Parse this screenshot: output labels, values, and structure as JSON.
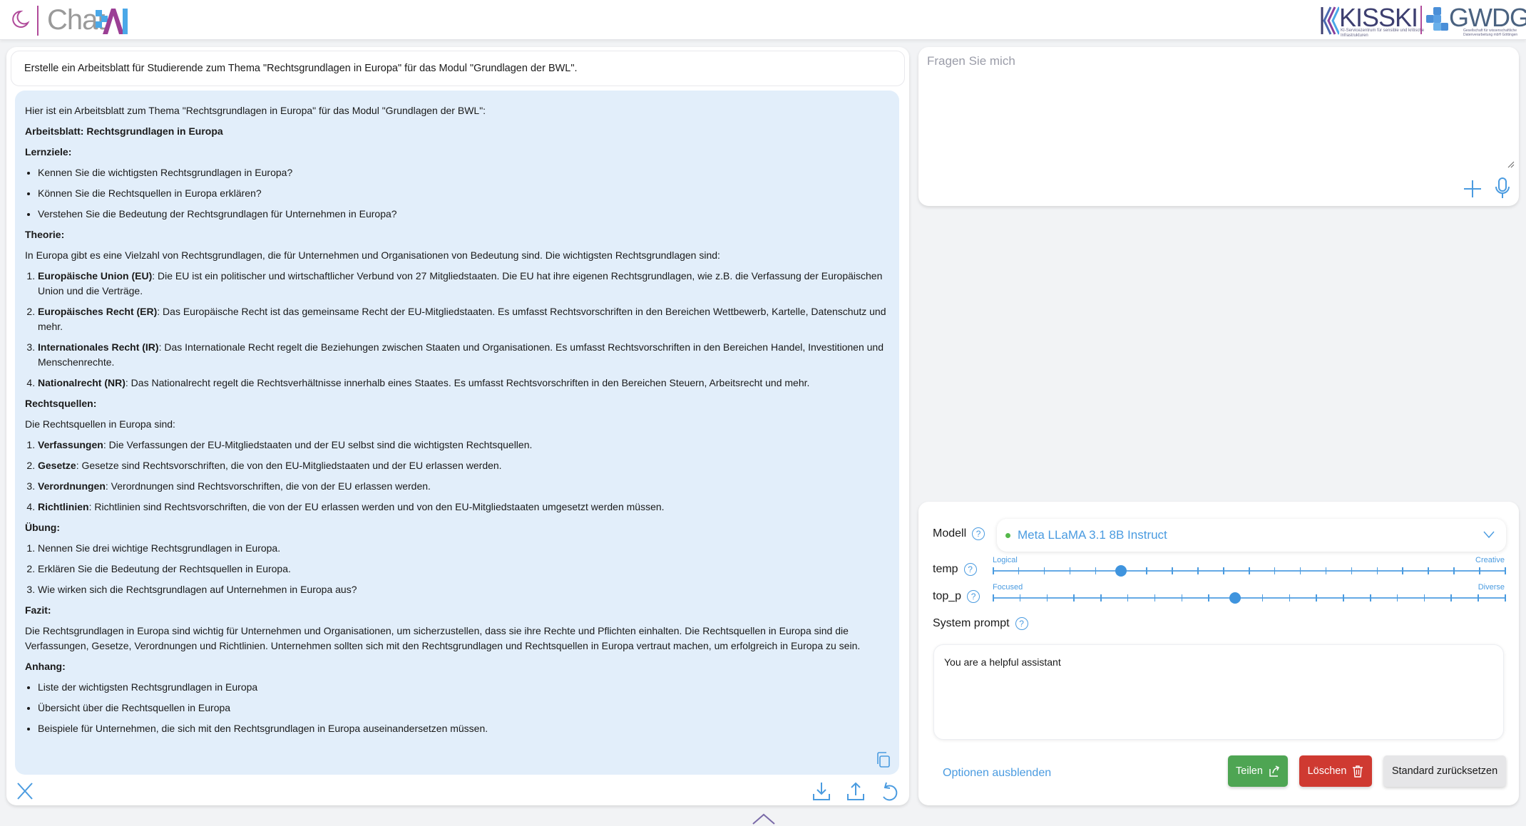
{
  "header": {
    "app_name_text": "Chat",
    "app_name_accent": "AI",
    "theme_icon": "moon-icon",
    "partner_logos": [
      {
        "name": "KISSKI",
        "subtitle": "KI-Servicezentrum für sensible und kritische Infrastrukturen"
      },
      {
        "name": "GWDG",
        "subtitle": "Gesellschaft für wissenschaftliche Datenverarbeitung mbH Göttingen"
      }
    ]
  },
  "chat": {
    "user_message": "Erstelle ein Arbeitsblatt für Studierende zum Thema \"Rechtsgrundlagen in Europa\" für das Modul \"Grundlagen der BWL\".",
    "assistant": {
      "intro": "Hier ist ein Arbeitsblatt zum Thema \"Rechtsgrundlagen in Europa\" für das Modul \"Grundlagen der BWL\":",
      "title": "Arbeitsblatt: Rechtsgrundlagen in Europa",
      "lernziele_heading": "Lernziele:",
      "lernziele": [
        "Kennen Sie die wichtigsten Rechtsgrundlagen in Europa?",
        "Können Sie die Rechtsquellen in Europa erklären?",
        "Verstehen Sie die Bedeutung der Rechtsgrundlagen für Unternehmen in Europa?"
      ],
      "theorie_heading": "Theorie:",
      "theorie_intro": "In Europa gibt es eine Vielzahl von Rechtsgrundlagen, die für Unternehmen und Organisationen von Bedeutung sind. Die wichtigsten Rechtsgrundlagen sind:",
      "theorie_items": [
        {
          "term": "Europäische Union (EU)",
          "text": ": Die EU ist ein politischer und wirtschaftlicher Verbund von 27 Mitgliedstaaten. Die EU hat ihre eigenen Rechtsgrundlagen, wie z.B. die Verfassung der Europäischen Union und die Verträge."
        },
        {
          "term": "Europäisches Recht (ER)",
          "text": ": Das Europäische Recht ist das gemeinsame Recht der EU-Mitgliedstaaten. Es umfasst Rechtsvorschriften in den Bereichen Wettbewerb, Kartelle, Datenschutz und mehr."
        },
        {
          "term": "Internationales Recht (IR)",
          "text": ": Das Internationale Recht regelt die Beziehungen zwischen Staaten und Organisationen. Es umfasst Rechtsvorschriften in den Bereichen Handel, Investitionen und Menschenrechte."
        },
        {
          "term": "Nationalrecht (NR)",
          "text": ": Das Nationalrecht regelt die Rechtsverhältnisse innerhalb eines Staates. Es umfasst Rechtsvorschriften in den Bereichen Steuern, Arbeitsrecht und mehr."
        }
      ],
      "quellen_heading": "Rechtsquellen:",
      "quellen_intro": "Die Rechtsquellen in Europa sind:",
      "quellen_items": [
        {
          "term": "Verfassungen",
          "text": ": Die Verfassungen der EU-Mitgliedstaaten und der EU selbst sind die wichtigsten Rechtsquellen."
        },
        {
          "term": "Gesetze",
          "text": ": Gesetze sind Rechtsvorschriften, die von den EU-Mitgliedstaaten und der EU erlassen werden."
        },
        {
          "term": "Verordnungen",
          "text": ": Verordnungen sind Rechtsvorschriften, die von der EU erlassen werden."
        },
        {
          "term": "Richtlinien",
          "text": ": Richtlinien sind Rechtsvorschriften, die von der EU erlassen werden und von den EU-Mitgliedstaaten umgesetzt werden müssen."
        }
      ],
      "uebung_heading": "Übung:",
      "uebung_items": [
        "Nennen Sie drei wichtige Rechtsgrundlagen in Europa.",
        "Erklären Sie die Bedeutung der Rechtsquellen in Europa.",
        "Wie wirken sich die Rechtsgrundlagen auf Unternehmen in Europa aus?"
      ],
      "fazit_heading": "Fazit:",
      "fazit_text": "Die Rechtsgrundlagen in Europa sind wichtig für Unternehmen und Organisationen, um sicherzustellen, dass sie ihre Rechte und Pflichten einhalten. Die Rechtsquellen in Europa sind die Verfassungen, Gesetze, Verordnungen und Richtlinien. Unternehmen sollten sich mit den Rechtsgrundlagen und Rechtsquellen in Europa vertraut machen, um erfolgreich in Europa zu sein.",
      "anhang_heading": "Anhang:",
      "anhang_items": [
        "Liste der wichtigsten Rechtsgrundlagen in Europa",
        "Übersicht über die Rechtsquellen in Europa",
        "Beispiele für Unternehmen, die sich mit den Rechtsgrundlagen in Europa auseinandersetzen müssen."
      ]
    }
  },
  "prompt": {
    "placeholder": "Fragen Sie mich",
    "value": ""
  },
  "settings": {
    "model_label": "Modell",
    "model_value": "Meta LLaMA 3.1 8B Instruct",
    "model_status_color": "#55b84a",
    "temp": {
      "label": "temp",
      "min_label": "Logical",
      "max_label": "Creative",
      "steps": 20,
      "value_fraction": 0.25
    },
    "top_p": {
      "label": "top_p",
      "min_label": "Focused",
      "max_label": "Diverse",
      "steps": 19,
      "value_fraction": 0.4737
    },
    "system_prompt_label": "System prompt",
    "system_prompt_value": "You are a helpful assistant",
    "toggle_options_label": "Optionen ausblenden",
    "share_label": "Teilen",
    "delete_label": "Löschen",
    "reset_label": "Standard zurücksetzen"
  },
  "colors": {
    "accent": "#4a9be0",
    "share": "#4ea553",
    "delete": "#cf3a31",
    "assistant_bubble": "#e2eefa"
  }
}
